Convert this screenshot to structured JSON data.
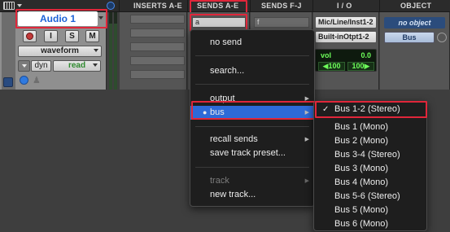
{
  "header": {
    "inserts_label": "INSERTS A-E",
    "sends_ae_label": "SENDS A-E",
    "sends_fj_label": "SENDS F-J",
    "io_label": "I / O",
    "object_label": "OBJECT"
  },
  "track": {
    "name": "Audio 1",
    "buttons": {
      "input": "I",
      "solo": "S",
      "mute": "M"
    },
    "view": "waveform",
    "automation_left": "dyn",
    "automation_mode": "read"
  },
  "sends": {
    "slot_a": "a",
    "slot_f": "f"
  },
  "io": {
    "input": "Mic/Line/Inst1-2",
    "output": "Built-inOtpt1-2",
    "vol_label": "vol",
    "vol_value": "0.0",
    "pan_left": "◀100",
    "pan_right": "100▶"
  },
  "object": {
    "status": "no object",
    "bus": "Bus"
  },
  "send_menu": {
    "items": [
      {
        "label": "no send"
      },
      {
        "label": "search..."
      },
      {
        "label": "output"
      },
      {
        "label": "bus"
      },
      {
        "label": "recall sends"
      },
      {
        "label": "save track preset..."
      },
      {
        "label": "track"
      },
      {
        "label": "new track..."
      }
    ]
  },
  "bus_menu": {
    "items": [
      {
        "label": "Bus 1-2 (Stereo)",
        "checked": true
      },
      {
        "label": "Bus 1 (Mono)"
      },
      {
        "label": "Bus 2 (Mono)"
      },
      {
        "label": "Bus 3-4 (Stereo)"
      },
      {
        "label": "Bus 3 (Mono)"
      },
      {
        "label": "Bus 4 (Mono)"
      },
      {
        "label": "Bus 5-6 (Stereo)"
      },
      {
        "label": "Bus 5 (Mono)"
      },
      {
        "label": "Bus 6 (Mono)"
      }
    ]
  },
  "colors": {
    "highlight": "#2d6ad8",
    "annotation_red": "#e0263a",
    "track_name_blue": "#1c63d8"
  }
}
